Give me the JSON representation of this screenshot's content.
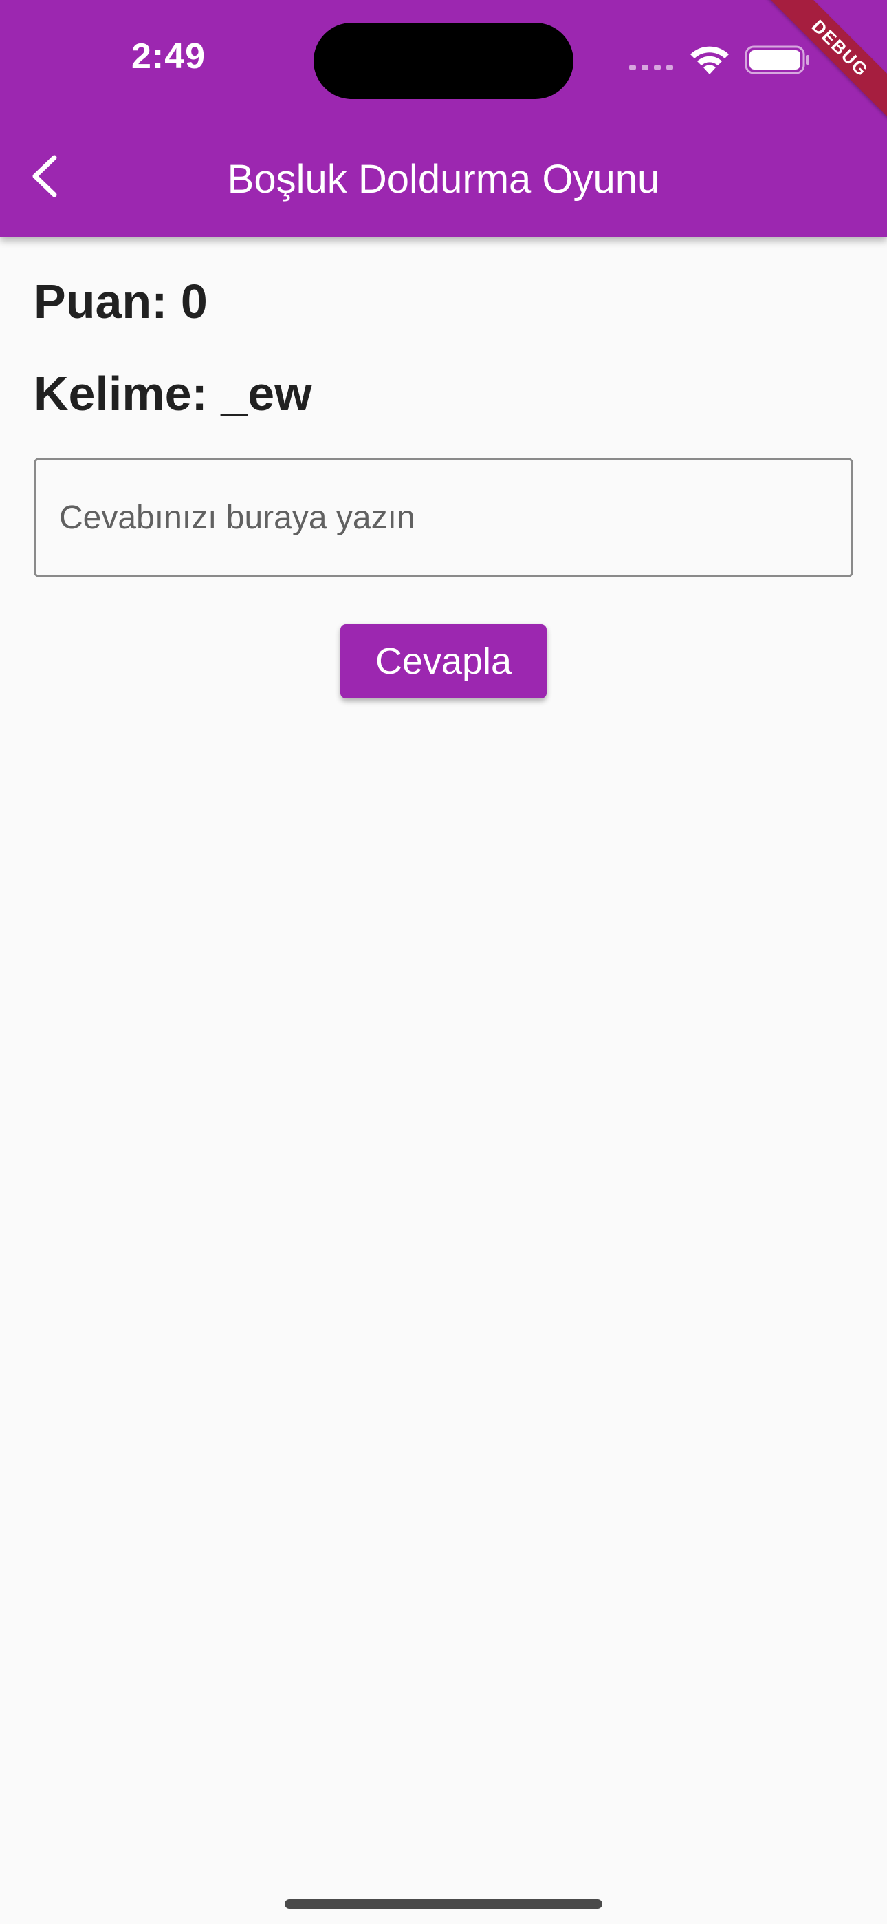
{
  "status_bar": {
    "time": "2:49",
    "icons": [
      "cell-signal-icon",
      "wifi-icon",
      "battery-icon"
    ]
  },
  "debug_banner": {
    "label": "DEBUG",
    "color": "#a61e3f"
  },
  "app_bar": {
    "title": "Boşluk Doldurma Oyunu",
    "back_icon": "chevron-left-icon",
    "color": "#9c27b0"
  },
  "game": {
    "score_text": "Puan: 0",
    "word_text": "Kelime: _ew",
    "answer_input": {
      "value": "",
      "placeholder": "Cevabınızı buraya yazın"
    },
    "submit_label": "Cevapla"
  },
  "colors": {
    "primary": "#9c27b0",
    "background": "#fafafa",
    "text": "#212121"
  }
}
